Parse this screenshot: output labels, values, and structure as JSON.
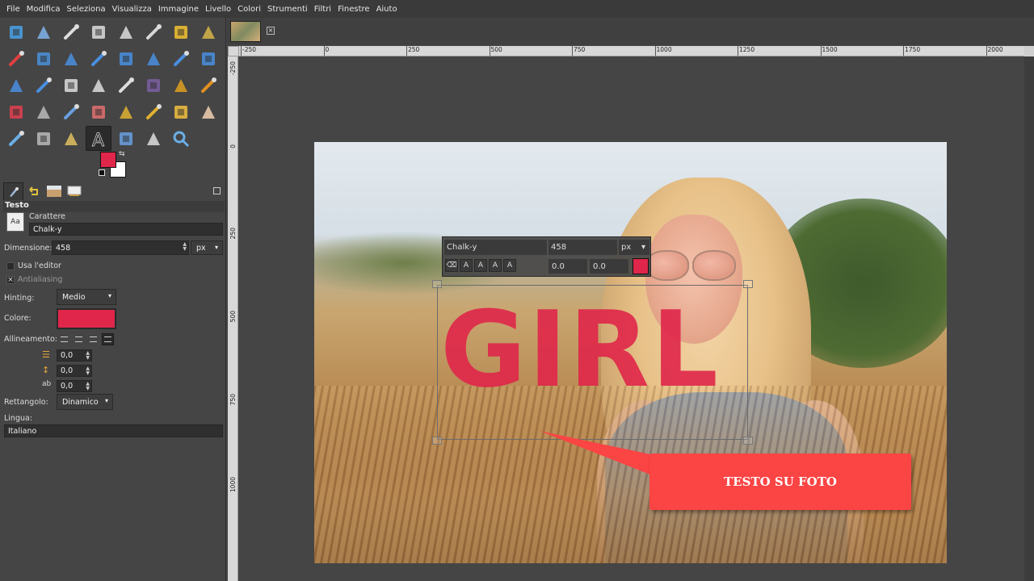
{
  "menubar": {
    "items": [
      "File",
      "Modifica",
      "Seleziona",
      "Visualizza",
      "Immagine",
      "Livello",
      "Colori",
      "Strumenti",
      "Filtri",
      "Finestre",
      "Aiuto"
    ]
  },
  "toolbox": {
    "tools": [
      "move-tool-icon",
      "align-tool-icon",
      "rect-select-icon",
      "ellipse-select-icon",
      "free-select-icon",
      "scissors-select-icon",
      "foreground-select-icon",
      "fuzzy-select-icon",
      "color-select-icon",
      "crop-tool-icon",
      "unified-transform-icon",
      "rotate-tool-icon",
      "scale-tool-icon",
      "shear-tool-icon",
      "flip-tool-icon",
      "perspective-tool-icon",
      "cage-transform-icon",
      "warp-transform-icon",
      "handle-transform-icon",
      "paths-tool-icon",
      "paint-select-icon",
      "text-dummy-icon",
      "paintbrush-icon",
      "pencil-icon",
      "airbrush-icon",
      "ink-tool-icon",
      "mypaint-brush-icon",
      "eraser-icon",
      "clone-tool-icon",
      "perspective-clone-icon",
      "heal-tool-icon",
      "smudge-tool-icon",
      "blur-tool-icon",
      "dodge-burn-icon",
      "bucket-fill-icon",
      "text-tool-icon",
      "color-picker-icon",
      "measure-tool-icon",
      "zoom-tool-icon"
    ],
    "fg_color": "#e0264a",
    "bg_color": "#ffffff"
  },
  "tool_options": {
    "title": "Testo",
    "font_label": "Carattere",
    "font_value": "Chalk-y",
    "size_label": "Dimensione:",
    "size_value": "458",
    "size_unit": "px",
    "use_editor_label": "Usa l'editor",
    "antialiasing_label": "Antialiasing",
    "hinting_label": "Hinting:",
    "hinting_value": "Medio",
    "color_label": "Colore:",
    "text_color": "#e0264a",
    "justify_label": "Allineamento:",
    "indent_value": "0,0",
    "line_spacing_value": "0,0",
    "letter_spacing_value": "0,0",
    "box_label": "Rettangolo:",
    "box_value": "Dinamico",
    "language_label": "Lingua:",
    "language_value": "Italiano"
  },
  "ruler": {
    "h_labels": [
      "-250",
      "0",
      "250",
      "500",
      "750",
      "1000",
      "1250",
      "1500",
      "1750",
      "2000"
    ],
    "v_labels": [
      "-250",
      "0",
      "250",
      "500",
      "750",
      "1000"
    ]
  },
  "canvas": {
    "text_layer": "GIRL",
    "toolbar": {
      "font": "Chalk-y",
      "size": "458",
      "unit": "px",
      "baseline": "0.0",
      "kerning": "0.0",
      "color": "#e0264a"
    },
    "callout_text": "TESTO SU FOTO",
    "callout_color": "#fb4444"
  }
}
